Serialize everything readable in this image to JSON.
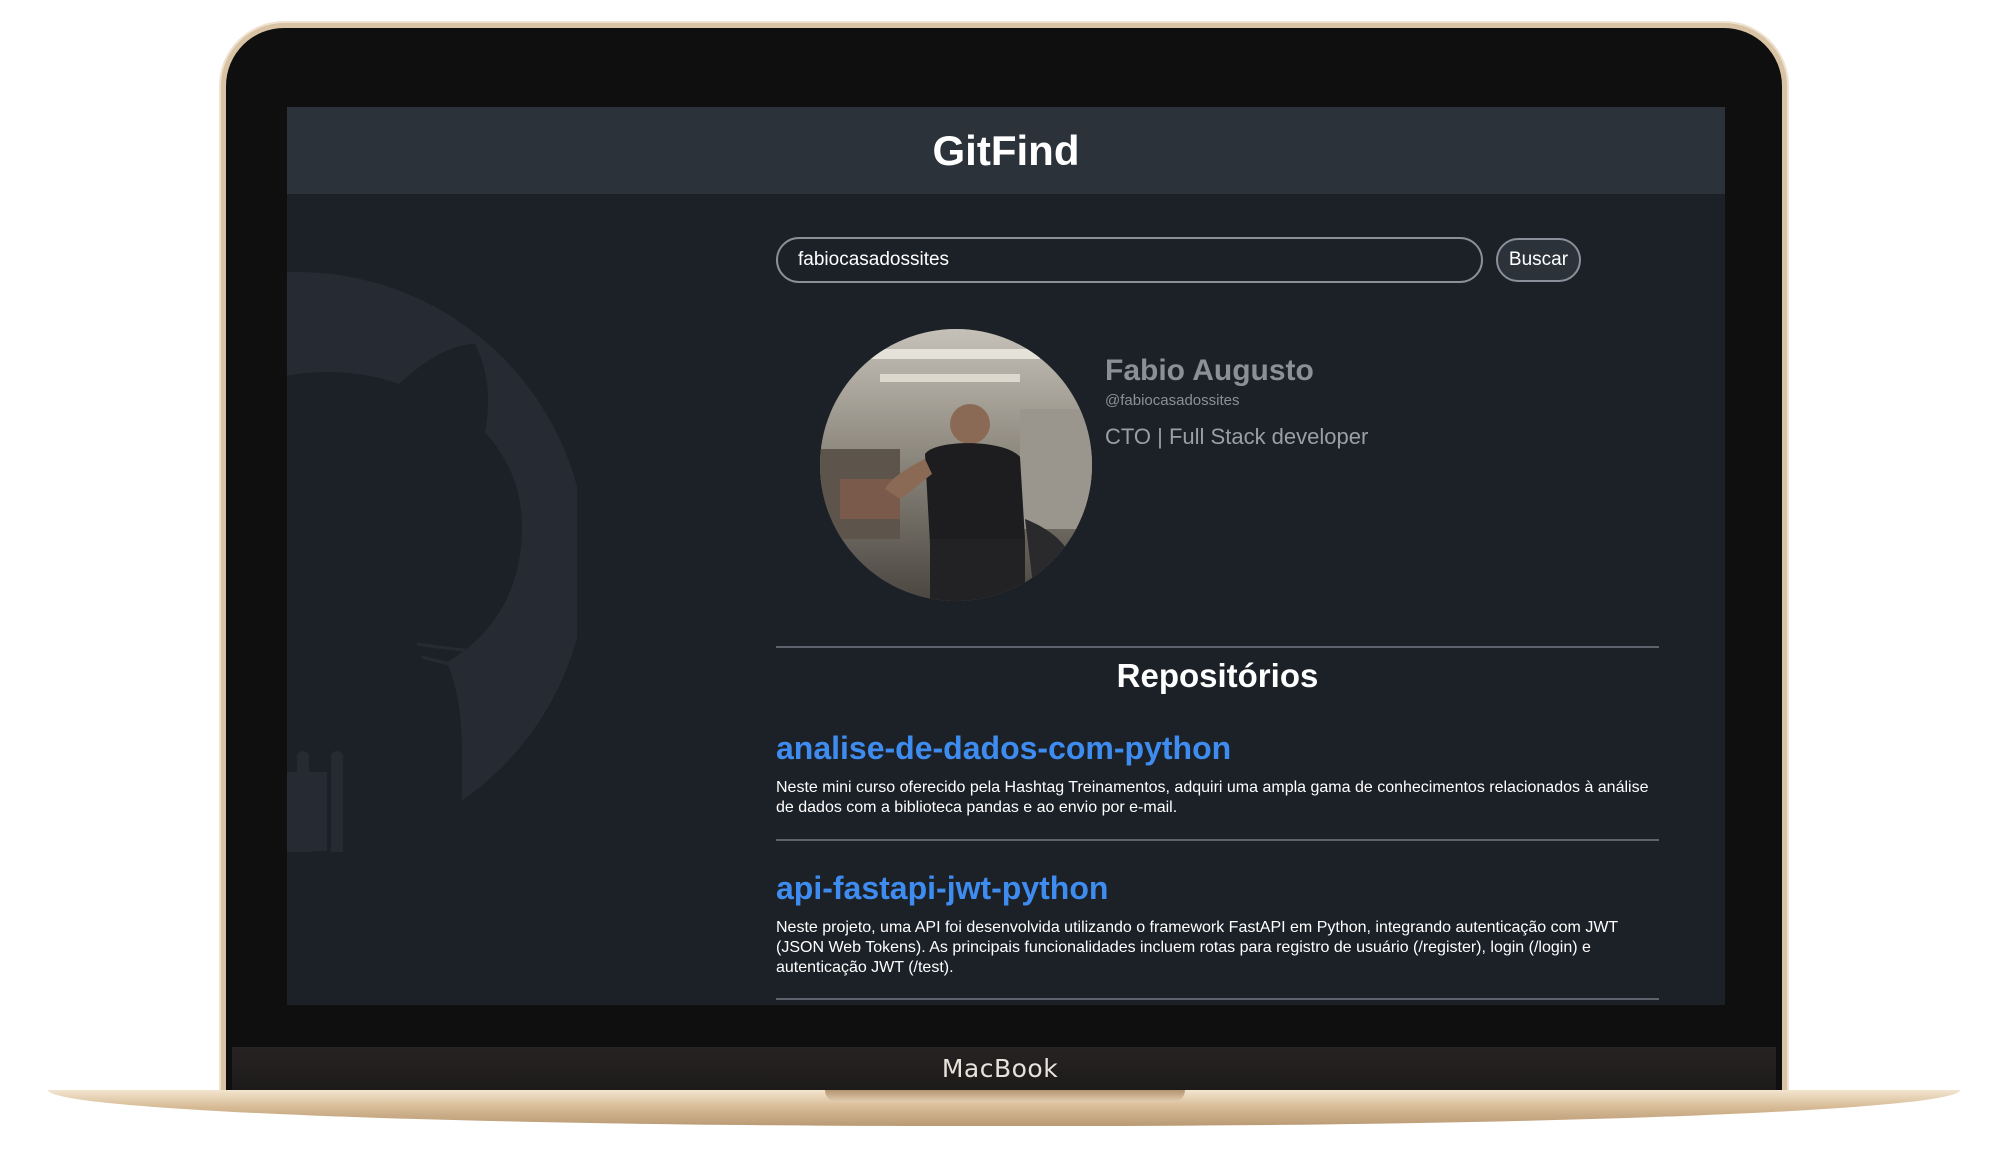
{
  "device": {
    "label": "MacBook"
  },
  "app": {
    "title": "GitFind"
  },
  "search": {
    "value": "fabiocasadossites",
    "button_label": "Buscar"
  },
  "profile": {
    "name": "Fabio Augusto",
    "login": "@fabiocasadossites",
    "bio": "CTO | Full Stack developer"
  },
  "repos": {
    "title": "Repositórios",
    "items": [
      {
        "name": "analise-de-dados-com-python",
        "description": "Neste mini curso oferecido pela Hashtag Treinamentos, adquiri uma ampla gama de conhecimentos relacionados à análise de dados com a biblioteca pandas e ao envio por e-mail."
      },
      {
        "name": "api-fastapi-jwt-python",
        "description": "Neste projeto, uma API foi desenvolvida utilizando o framework FastAPI em Python, integrando autenticação com JWT (JSON Web Tokens). As principais funcionalidades incluem rotas para registro de usuário (/register), login (/login) e autenticação JWT (/test)."
      }
    ]
  },
  "colors": {
    "background": "#1c2128",
    "header": "#2c323a",
    "link": "#3f8cf0"
  },
  "icons": [
    "github-octocat-icon"
  ]
}
